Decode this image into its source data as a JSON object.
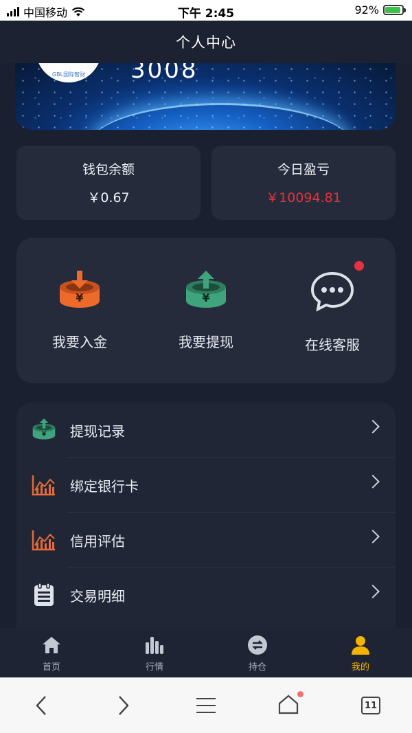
{
  "status_bar": {
    "carrier": "中国移动",
    "time": "下午 2:45",
    "battery": "92%"
  },
  "header": {
    "title": "个人中心"
  },
  "banner": {
    "user_id": "3008",
    "logo_text": "GBL国际智财"
  },
  "stats": {
    "wallet_label": "钱包余额",
    "wallet_value": "￥0.67",
    "pnl_label": "今日盈亏",
    "pnl_value": "￥10094.81"
  },
  "actions": [
    {
      "label": "我要入金",
      "icon": "deposit-icon"
    },
    {
      "label": "我要提现",
      "icon": "withdraw-icon"
    },
    {
      "label": "在线客服",
      "icon": "chat-icon"
    }
  ],
  "menu": [
    {
      "label": "提现记录",
      "icon": "withdraw-record-icon"
    },
    {
      "label": "绑定银行卡",
      "icon": "chart-icon"
    },
    {
      "label": "信用评估",
      "icon": "chart-icon"
    },
    {
      "label": "交易明细",
      "icon": "clipboard-icon"
    }
  ],
  "tabbar": [
    {
      "label": "首页",
      "icon": "home-icon"
    },
    {
      "label": "行情",
      "icon": "bar-chart-icon"
    },
    {
      "label": "持仓",
      "icon": "exchange-icon"
    },
    {
      "label": "我的",
      "icon": "user-icon",
      "active": true
    }
  ],
  "browser": {
    "tab_count": "11"
  },
  "colors": {
    "background": "#1a2030",
    "card": "#252b3b",
    "loss_red": "#e3323a",
    "deposit_orange": "#ee6a2b",
    "withdraw_green": "#3fa37d",
    "active_tab": "#f4b400"
  }
}
